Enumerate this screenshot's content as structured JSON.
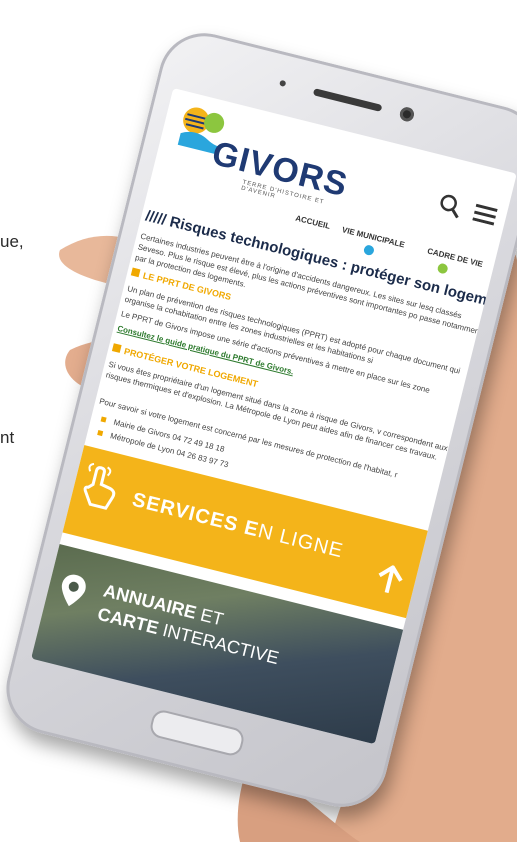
{
  "background_text": {
    "line1": "ue,",
    "line2": "nt"
  },
  "site": {
    "logo_text": "GIVORS",
    "logo_tagline": "TERRE D'HISTOIRE ET D'AVENIR"
  },
  "nav": {
    "items": [
      "ACCUEIL",
      "VIE MUNICIPALE",
      "CADRE DE VIE"
    ]
  },
  "page": {
    "title": "///// Risques technologiques : protéger son logement",
    "intro": "Certaines industries peuvent être à l'origine d'accidents dangereux. Les sites sur lesq classés Seveso. Plus le risque est élevé, plus les actions préventives sont importantes po passe notamment par la protection des logements.",
    "section1_title": "LE PPRT DE GIVORS",
    "section1_p1": "Un plan de prévention des risques technologiques (PPRT) est adopté pour chaque document qui organise la cohabitation entre les zones industrielles et les habitations si",
    "section1_p2": "Le PPRT de Givors impose une série d'actions préventives à mettre en place sur les zone",
    "section1_link": "Consultez le guide pratique du PPRT de Givors.",
    "section2_title": "PROTÉGER VOTRE LOGEMENT",
    "section2_p1": "Si vous êtes propriétaire d'un logement situé dans la zone à risque de Givors, v correspondent aux risques thermiques et d'explosion. La Métropole de Lyon peut aides afin de financer ces travaux.",
    "section2_p2": "Pour savoir si votre logement est concerné par les mesures de protection de l'habitat, r",
    "contacts": [
      "Mairie de Givors 04 72 49 18 18",
      "Métropole de Lyon 04 26 83 97 73"
    ]
  },
  "services": {
    "bold": "SERVICES E",
    "light": "N LIGNE"
  },
  "annuaire": {
    "line1_bold": "ANNUAIRE",
    "line1_light": " ET",
    "line2_bold": "CARTE",
    "line2_light": " INTERACTIVE"
  },
  "colors": {
    "brand_yellow": "#f4b41a",
    "brand_blue": "#1f3a73",
    "link_green": "#2d7a2d"
  },
  "icons": [
    "search-icon",
    "menu-icon",
    "hand-tap-icon",
    "arrow-up-icon",
    "location-pin-icon"
  ]
}
